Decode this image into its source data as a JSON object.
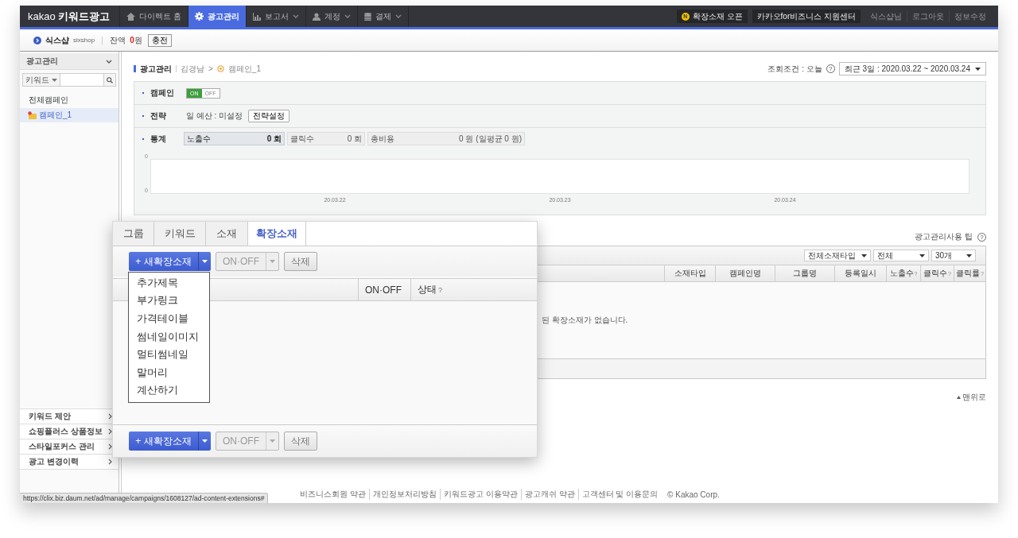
{
  "topbar": {
    "brand": "kakao",
    "product": "키워드광고",
    "nav": [
      {
        "label": "다이렉트 홈",
        "selected": false,
        "has_menu": false
      },
      {
        "label": "광고관리",
        "selected": true,
        "has_menu": false
      },
      {
        "label": "보고서",
        "selected": false,
        "has_menu": true
      },
      {
        "label": "계정",
        "selected": false,
        "has_menu": true
      },
      {
        "label": "결제",
        "selected": false,
        "has_menu": true
      }
    ],
    "notice": {
      "badge": "N",
      "label": "확장소재 오픈"
    },
    "support": "카카오for비즈니스 지원센터",
    "user_links": [
      "식스샵님",
      "로그아웃",
      "정보수정"
    ]
  },
  "account": {
    "name": "식스샵",
    "id": "sixshop",
    "balance_label": "잔액",
    "balance_amount": "0",
    "balance_unit": "원",
    "charge": "충전"
  },
  "sidebar": {
    "title": "광고관리",
    "expanded": true,
    "search_filter": "키워드",
    "tree": [
      {
        "label": "전체캠페인",
        "selected": false,
        "children": [
          {
            "label": "캠페인_1",
            "selected": true
          }
        ]
      }
    ],
    "menu": [
      "키워드 제안",
      "쇼핑플러스 상품정보",
      "스타일포커스 관리",
      "광고 변경이력"
    ]
  },
  "content": {
    "breadcrumb": [
      "광고관리",
      "김경남",
      "캠페인_1"
    ],
    "breadcrumb_separator": ">",
    "query_label": "조회조건 : 오늘",
    "query_help": "?",
    "date_range": "최근 3일 : 2020.03.22 ~ 2020.03.24",
    "campaign": {
      "label": "캠페인",
      "on": true,
      "on_text": "ON",
      "off_text": "OFF"
    },
    "strategy": {
      "label": "전략",
      "budget": "일 예산 : 미설정",
      "button": "전략설정"
    },
    "stats": {
      "label": "통계",
      "items": [
        {
          "name": "노출수",
          "value": "0 회",
          "selected": true
        },
        {
          "name": "클릭수",
          "value": "0 회",
          "selected": false
        },
        {
          "name": "총비용",
          "value": "0 원 (일평균 0 원)",
          "selected": false
        }
      ]
    },
    "chart": {
      "y_labels": [
        "0",
        "0"
      ],
      "x_labels": [
        "20.03.22",
        "20.03.23",
        "20.03.24"
      ]
    },
    "tip": "광고관리사용 팁",
    "tip_help": "?",
    "filters": [
      "전체소재타입",
      "전체",
      "30개"
    ],
    "columns": [
      {
        "label": "소재타입"
      },
      {
        "label": "캠페인명"
      },
      {
        "label": "그룹명"
      },
      {
        "label": "등록일시"
      },
      {
        "label": "노출수",
        "help": "?"
      },
      {
        "label": "클릭수",
        "help": "?"
      },
      {
        "label": "클릭률",
        "help": "?"
      }
    ],
    "empty_message": "된 확장소재가 없습니다.",
    "to_top": "맨위로"
  },
  "overlay": {
    "tabs": [
      {
        "label": "그룹",
        "selected": false
      },
      {
        "label": "키워드",
        "selected": false
      },
      {
        "label": "소재",
        "selected": false
      },
      {
        "label": "확장소재",
        "selected": true
      }
    ],
    "toolbars": [
      {
        "new_button": "+ 새확장소재",
        "onoff": "ON·OFF",
        "onoff_disabled": true,
        "delete": "삭제"
      },
      {
        "new_button": "+ 새확장소재",
        "onoff": "ON·OFF",
        "onoff_disabled": true,
        "delete": "삭제"
      }
    ],
    "columns": [
      {
        "label": "ON·OFF"
      },
      {
        "label": "상태",
        "help": "?"
      }
    ],
    "menu": [
      "추가제목",
      "부가링크",
      "가격테이블",
      "썸네일이미지",
      "멀티썸네일",
      "말머리",
      "계산하기"
    ]
  },
  "footer": {
    "links": [
      "비즈니스회원 약관",
      "개인정보처리방침",
      "키워드광고 이용약관",
      "광고캐쉬 약관",
      "고객센터 및 이용문의"
    ],
    "copyright": "© Kakao Corp."
  },
  "status_url": "https://clix.biz.daum.net/ad/manage/campaigns/1608127/ad-content-extensions#"
}
